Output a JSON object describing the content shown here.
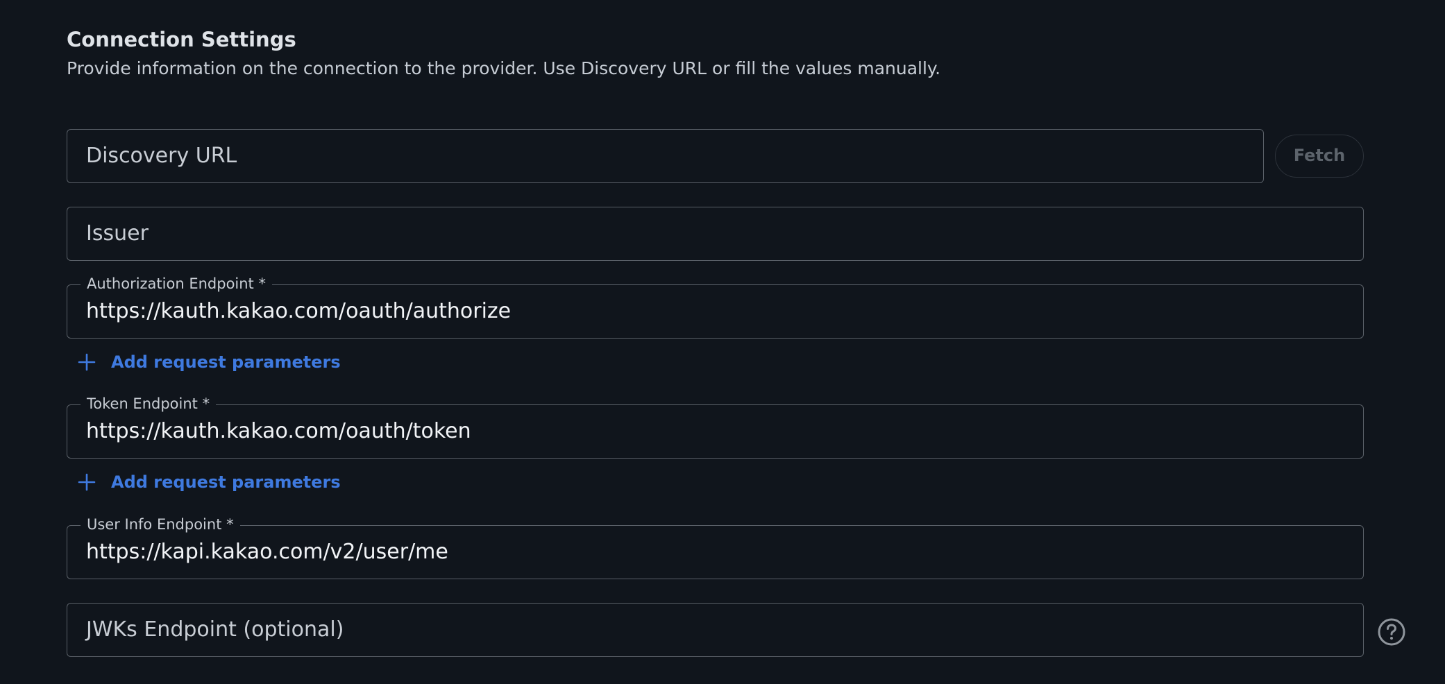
{
  "section": {
    "title": "Connection Settings",
    "description": "Provide information on the connection to the provider. Use Discovery URL or fill the values manually."
  },
  "discovery": {
    "placeholder": "Discovery URL",
    "fetch_label": "Fetch"
  },
  "issuer": {
    "placeholder": "Issuer"
  },
  "authorization": {
    "label": "Authorization Endpoint *",
    "value": "https://kauth.kakao.com/oauth/authorize",
    "add_params_label": "Add request parameters"
  },
  "token": {
    "label": "Token Endpoint *",
    "value": "https://kauth.kakao.com/oauth/token",
    "add_params_label": "Add request parameters"
  },
  "userinfo": {
    "label": "User Info Endpoint *",
    "value": "https://kapi.kakao.com/v2/user/me"
  },
  "jwks": {
    "placeholder": "JWKs Endpoint (optional)",
    "help_icon": "help-circle-icon"
  },
  "colors": {
    "background": "#10151c",
    "accent": "#3f7ae0",
    "border": "#5a6068"
  }
}
